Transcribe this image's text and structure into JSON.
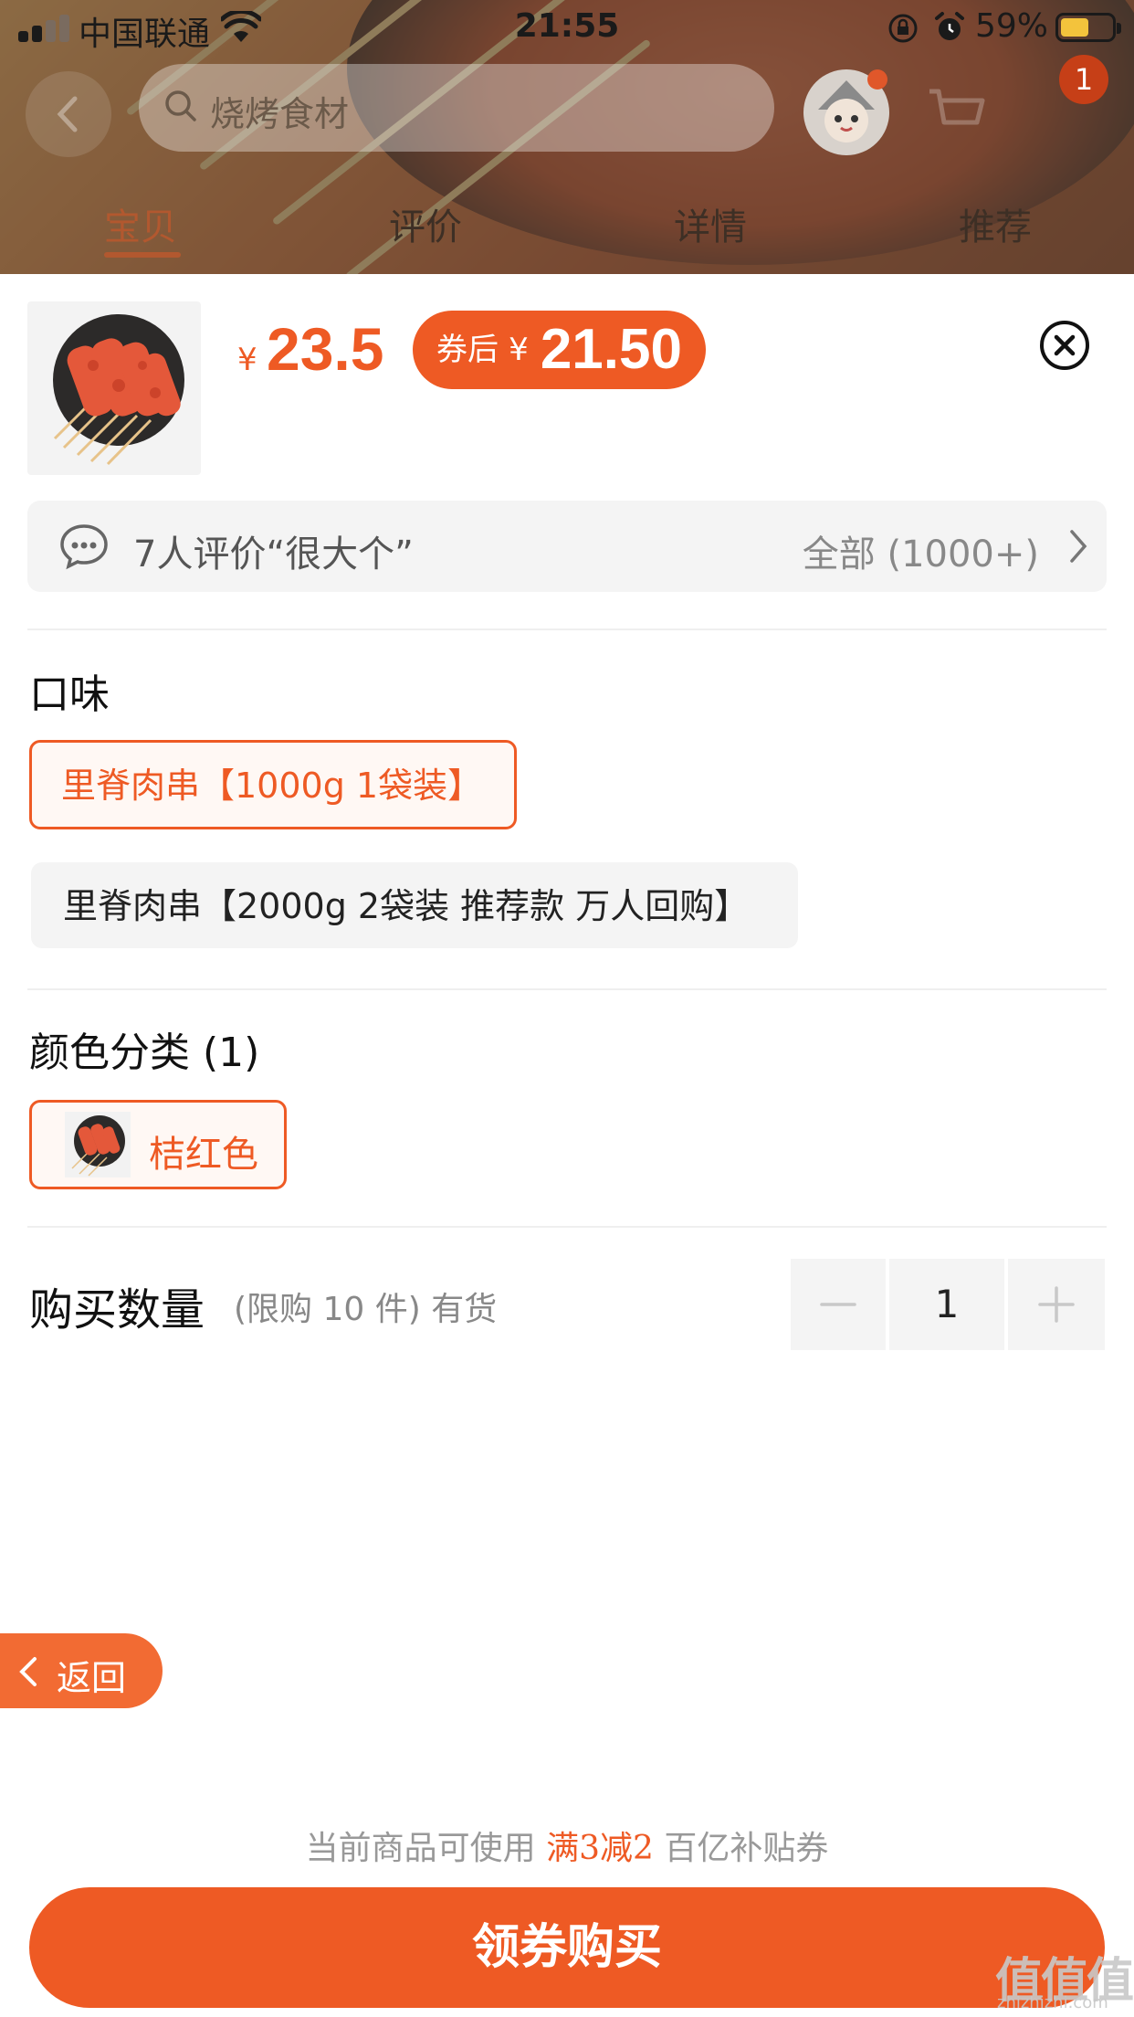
{
  "status_bar": {
    "carrier": "中国联通",
    "time": "21:55",
    "battery_percent": "59%"
  },
  "header": {
    "search_placeholder": "烧烤食材",
    "cart_count": "1",
    "tabs": [
      {
        "label": "宝贝",
        "active": true
      },
      {
        "label": "评价",
        "active": false
      },
      {
        "label": "详情",
        "active": false
      },
      {
        "label": "推荐",
        "active": false
      }
    ]
  },
  "sku_panel": {
    "price_currency": "¥",
    "price": "23.5",
    "coupon_label": "券后",
    "coupon_currency": "¥",
    "coupon_price": "21.50",
    "review_summary": "7人评价“很大个”",
    "review_all": "全部 (1000+)",
    "flavor": {
      "title": "口味",
      "options": [
        {
          "label": "里脊肉串【1000g 1袋装】",
          "selected": true
        },
        {
          "label": "里脊肉串【2000g 2袋装 推荐款 万人回购】",
          "selected": false
        }
      ]
    },
    "color": {
      "title": "颜色分类 (1)",
      "options": [
        {
          "label": "桔红色",
          "selected": true
        }
      ]
    },
    "quantity": {
      "title": "购买数量",
      "note": "(限购 10 件) 有货",
      "value": "1"
    },
    "back_label": "返回",
    "promo": {
      "prefix": "当前商品可使用 ",
      "highlight": "满3减2",
      "suffix": " 百亿补贴券"
    },
    "buy_button": "领券购买"
  },
  "watermark": {
    "logo": "值值值",
    "domain": "zhizhizhi.com"
  },
  "colors": {
    "accent": "#ee5a24",
    "accent_light_bg": "#fff8f4",
    "chip_bg": "#f4f4f4",
    "muted_text": "#888888"
  }
}
